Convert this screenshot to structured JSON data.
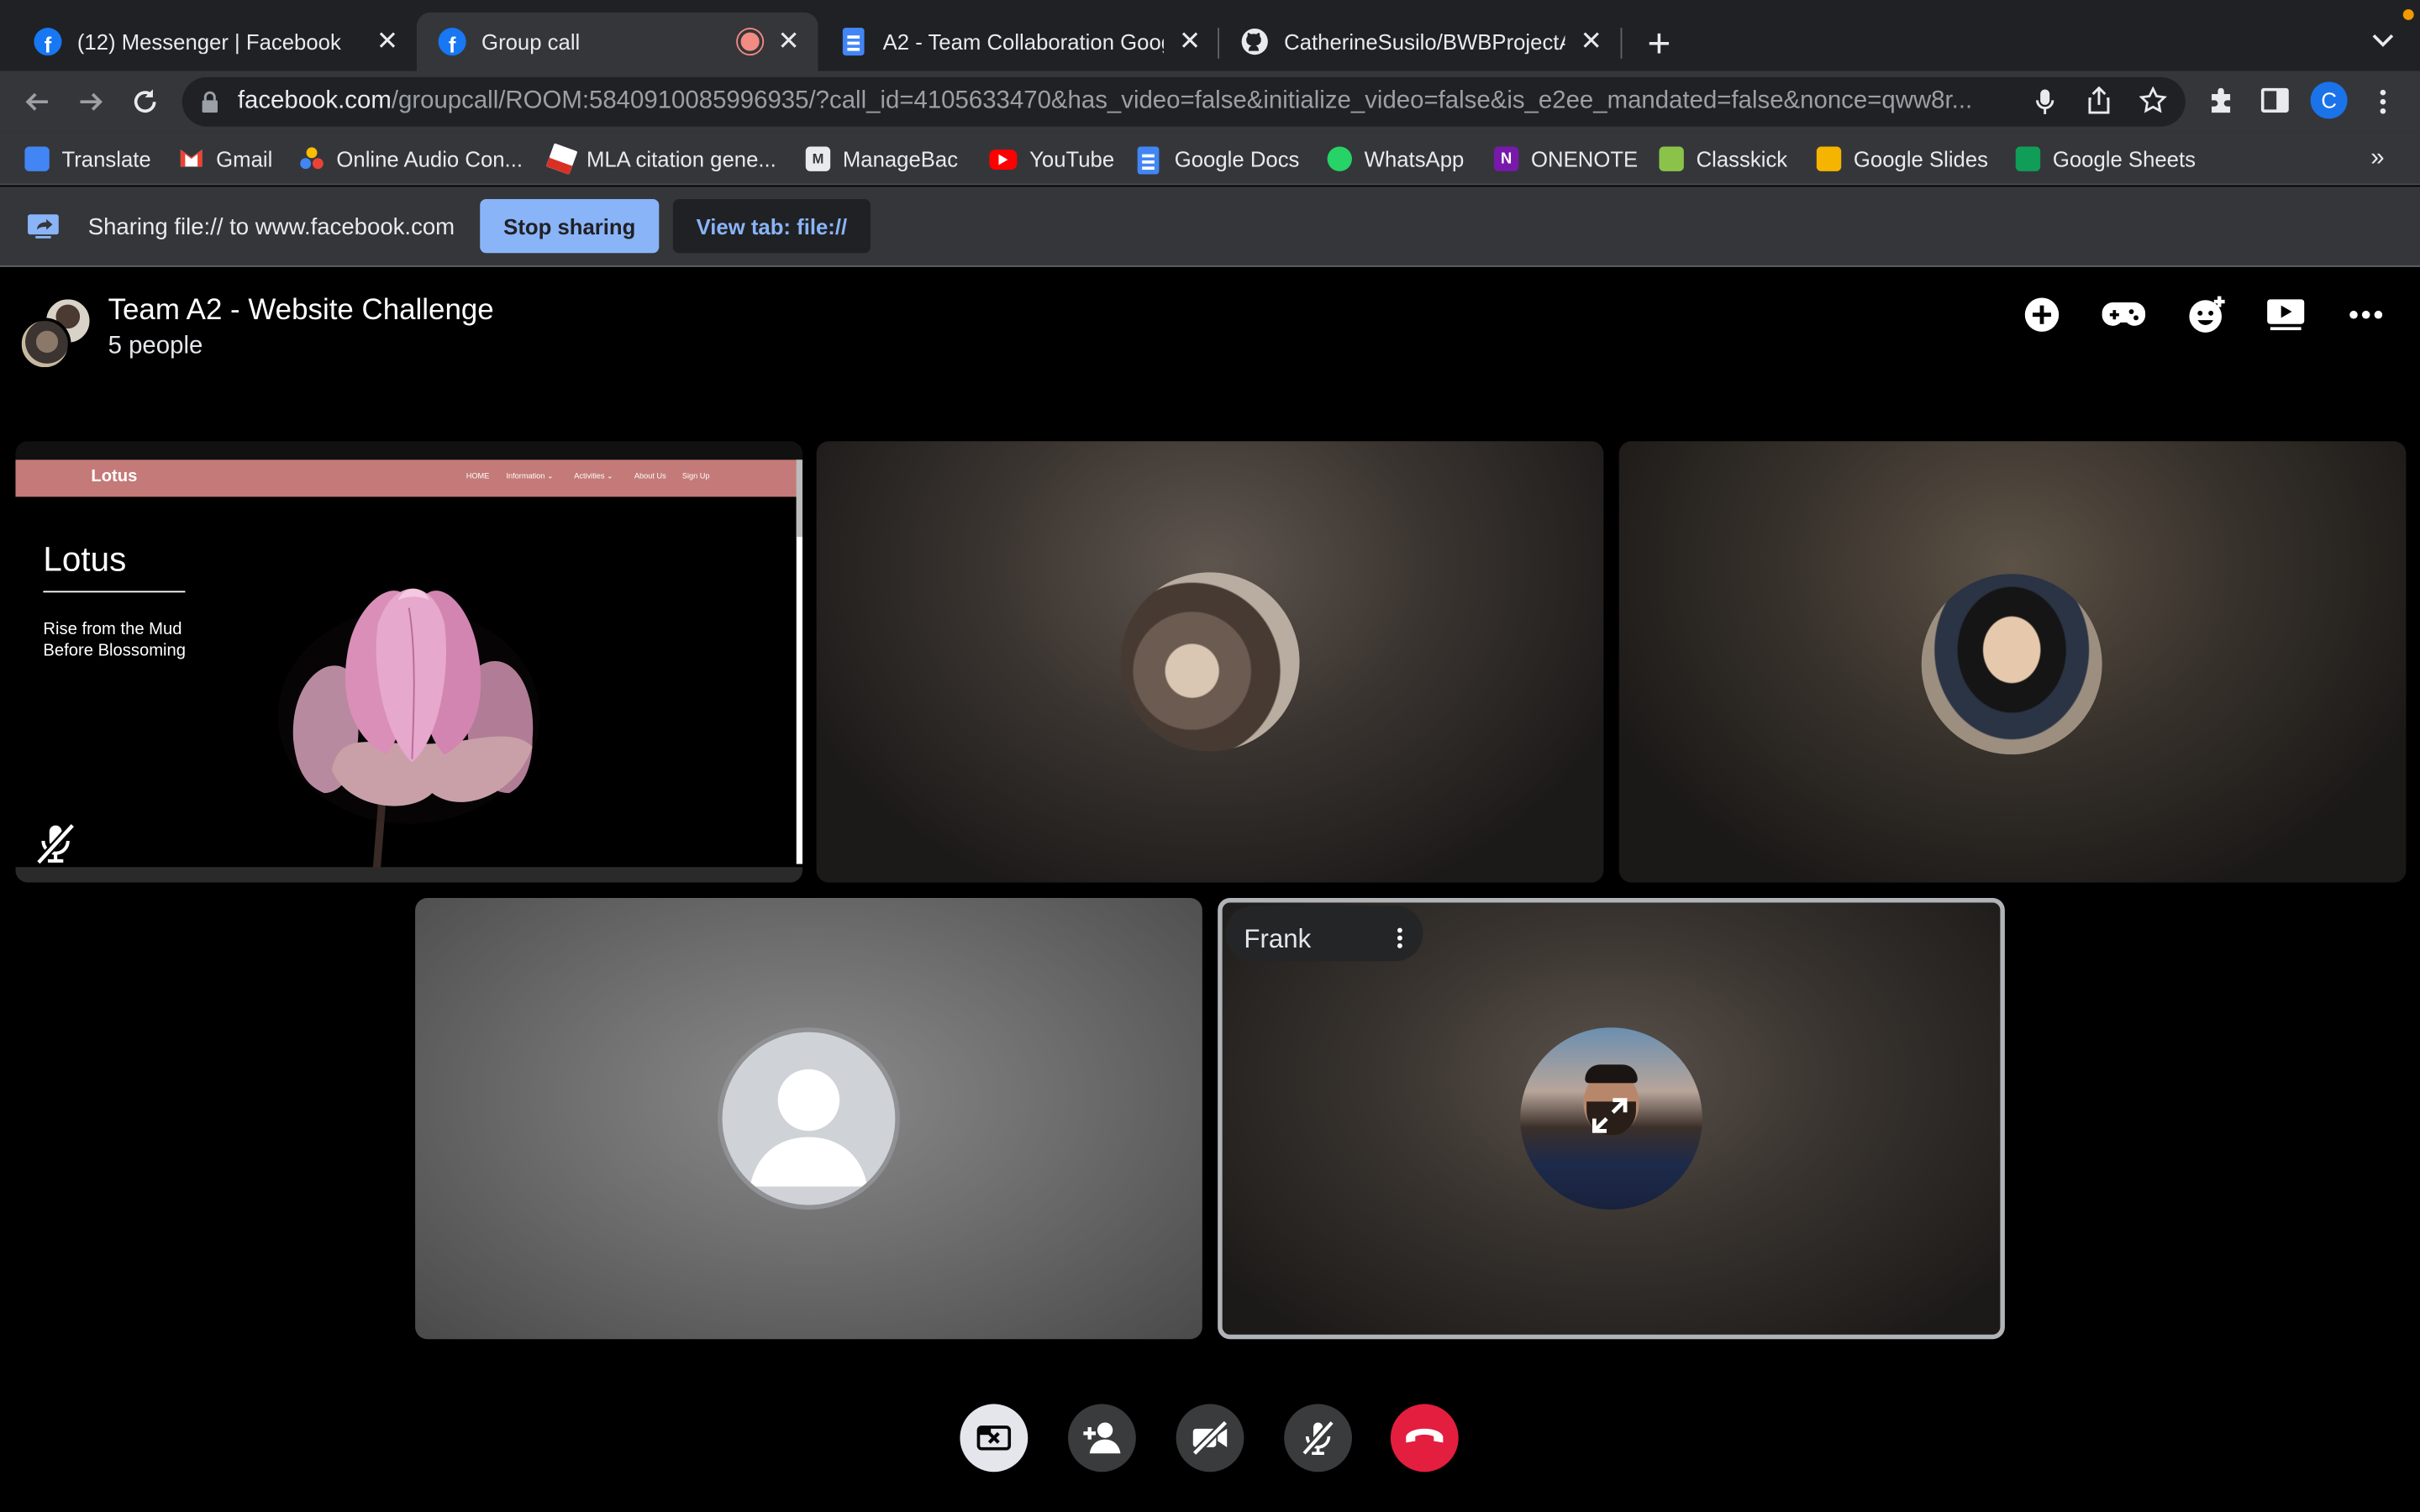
{
  "browser": {
    "tabs": [
      {
        "title": "(12) Messenger | Facebook",
        "favicon": "facebook-icon"
      },
      {
        "title": "Group call",
        "favicon": "facebook-icon",
        "recording": true
      },
      {
        "title": "A2 - Team Collaboration Googl",
        "favicon": "google-docs-icon"
      },
      {
        "title": "CatherineSusilo/BWBProjectA2",
        "favicon": "github-icon"
      }
    ],
    "url_host": "facebook.com",
    "url_path": "/groupcall/ROOM:5840910085996935/?call_id=4105633470&has_video=false&initialize_video=false&is_e2ee_mandated=false&nonce=qww8r...",
    "profile_initial": "C",
    "bookmarks": [
      {
        "label": "Translate",
        "color": "#4285f4"
      },
      {
        "label": "Gmail",
        "color": "#ea4335"
      },
      {
        "label": "Online Audio Con...",
        "color": "#fbbc04"
      },
      {
        "label": "MLA citation gene...",
        "color": "#d93025"
      },
      {
        "label": "ManageBac",
        "color": "#e8eaed"
      },
      {
        "label": "YouTube",
        "color": "#ff0000"
      },
      {
        "label": "Google Docs",
        "color": "#4285f4"
      },
      {
        "label": "WhatsApp",
        "color": "#25d366"
      },
      {
        "label": "ONENOTE",
        "color": "#7719aa"
      },
      {
        "label": "Classkick",
        "color": "#8bc34a"
      },
      {
        "label": "Google Slides",
        "color": "#f4b400"
      },
      {
        "label": "Google Sheets",
        "color": "#0f9d58"
      }
    ],
    "more_bookmarks": "»"
  },
  "sharebar": {
    "text": "Sharing file:// to www.facebook.com",
    "stop_label": "Stop sharing",
    "view_label": "View tab: file://"
  },
  "call": {
    "title": "Team A2 - Website Challenge",
    "subtitle": "5 people",
    "frank_name": "Frank"
  },
  "shared_site": {
    "brand": "Lotus",
    "nav": [
      "HOME",
      "Information ⌄",
      "Activities ⌄",
      "About Us",
      "Sign Up"
    ],
    "heading": "Lotus",
    "tagline_1": "Rise from the Mud",
    "tagline_2": "Before Blossoming"
  },
  "colors": {
    "accent": "#8ab4f8",
    "end_call": "#e41e3f",
    "messenger_blue": "#1877f2"
  }
}
